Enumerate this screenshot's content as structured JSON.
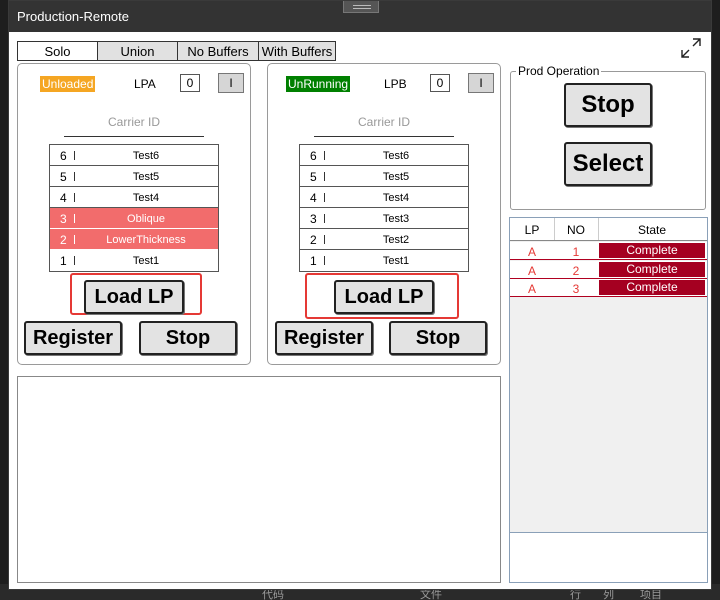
{
  "window": {
    "title": "Production-Remote"
  },
  "tabs": [
    {
      "label": "Solo",
      "active": true
    },
    {
      "label": "Union",
      "active": false
    },
    {
      "label": "No Buffers",
      "active": false
    },
    {
      "label": "With Buffers",
      "active": false
    }
  ],
  "lp_a": {
    "status": "Unloaded",
    "status_color": "#f5a623",
    "name": "LPA",
    "count": "0",
    "toggle": "I",
    "carrier_label": "Carrier ID",
    "slots": [
      {
        "num": "6",
        "name": "Test6",
        "highlight": false
      },
      {
        "num": "5",
        "name": "Test5",
        "highlight": false
      },
      {
        "num": "4",
        "name": "Test4",
        "highlight": false
      },
      {
        "num": "3",
        "name": "Oblique",
        "highlight": true
      },
      {
        "num": "2",
        "name": "LowerThickness",
        "highlight": true
      },
      {
        "num": "1",
        "name": "Test1",
        "highlight": false
      }
    ],
    "load_label": "Load LP",
    "register_label": "Register",
    "stop_label": "Stop"
  },
  "lp_b": {
    "status": "UnRunning",
    "status_color": "#008000",
    "name": "LPB",
    "count": "0",
    "toggle": "I",
    "carrier_label": "Carrier ID",
    "slots": [
      {
        "num": "6",
        "name": "Test6",
        "highlight": false
      },
      {
        "num": "5",
        "name": "Test5",
        "highlight": false
      },
      {
        "num": "4",
        "name": "Test4",
        "highlight": false
      },
      {
        "num": "3",
        "name": "Test3",
        "highlight": false
      },
      {
        "num": "2",
        "name": "Test2",
        "highlight": false
      },
      {
        "num": "1",
        "name": "Test1",
        "highlight": false
      }
    ],
    "load_label": "Load LP",
    "register_label": "Register",
    "stop_label": "Stop"
  },
  "prod_operation": {
    "label": "Prod Operation",
    "stop_label": "Stop",
    "select_label": "Select"
  },
  "state_table": {
    "columns": [
      "LP",
      "NO",
      "State"
    ],
    "rows": [
      {
        "lp": "A",
        "no": "1",
        "state": "Complete"
      },
      {
        "lp": "A",
        "no": "2",
        "state": "Complete"
      },
      {
        "lp": "A",
        "no": "3",
        "state": "Complete"
      }
    ]
  },
  "background": {
    "bottom_items": [
      "代码",
      "文件",
      "行",
      "列",
      "项目"
    ]
  },
  "colors": {
    "highlight_slot": "#f26c6c",
    "complete_state": "#a50021",
    "annotation_box": "#e53935"
  }
}
